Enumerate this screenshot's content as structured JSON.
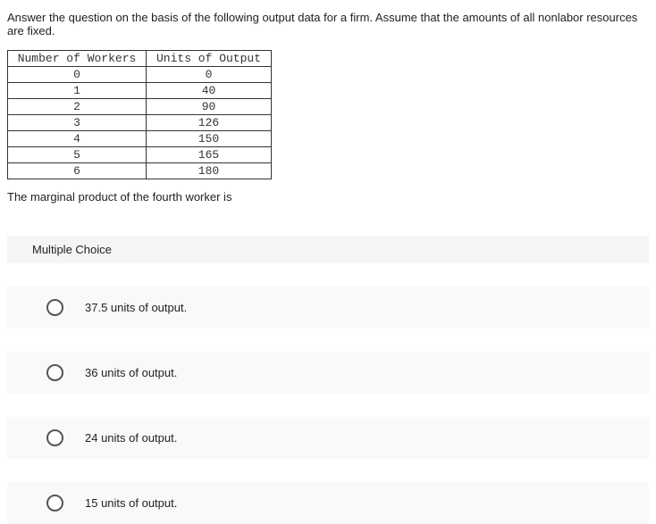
{
  "question_intro": "Answer the question on the basis of the following output data for a firm. Assume that the amounts of all nonlabor resources are fixed.",
  "chart_data": {
    "type": "table",
    "columns": [
      "Number of Workers",
      "Units of Output"
    ],
    "rows": [
      {
        "workers": "0",
        "output": "0"
      },
      {
        "workers": "1",
        "output": "40"
      },
      {
        "workers": "2",
        "output": "90"
      },
      {
        "workers": "3",
        "output": "126"
      },
      {
        "workers": "4",
        "output": "150"
      },
      {
        "workers": "5",
        "output": "165"
      },
      {
        "workers": "6",
        "output": "180"
      }
    ]
  },
  "question_prompt": "The marginal product of the fourth worker is",
  "multiple_choice_label": "Multiple Choice",
  "choices": [
    {
      "text": "37.5 units of output."
    },
    {
      "text": "36 units of output."
    },
    {
      "text": "24 units of output."
    },
    {
      "text": "15 units of output."
    }
  ]
}
